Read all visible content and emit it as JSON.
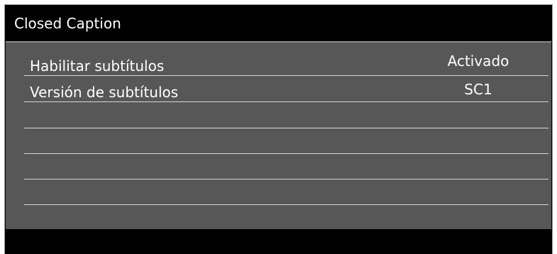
{
  "panel": {
    "title": "Closed Caption"
  },
  "rows": [
    {
      "label": "Habilitar subtítulos",
      "value": "Activado"
    },
    {
      "label": "Versión de subtítulos",
      "value": "SC1"
    },
    {
      "label": "",
      "value": ""
    },
    {
      "label": "",
      "value": ""
    },
    {
      "label": "",
      "value": ""
    },
    {
      "label": "",
      "value": ""
    }
  ],
  "colors": {
    "title_background": "#000000",
    "content_background": "#575757",
    "text": "#ffffff",
    "row_divider": "#d8d8d8"
  }
}
